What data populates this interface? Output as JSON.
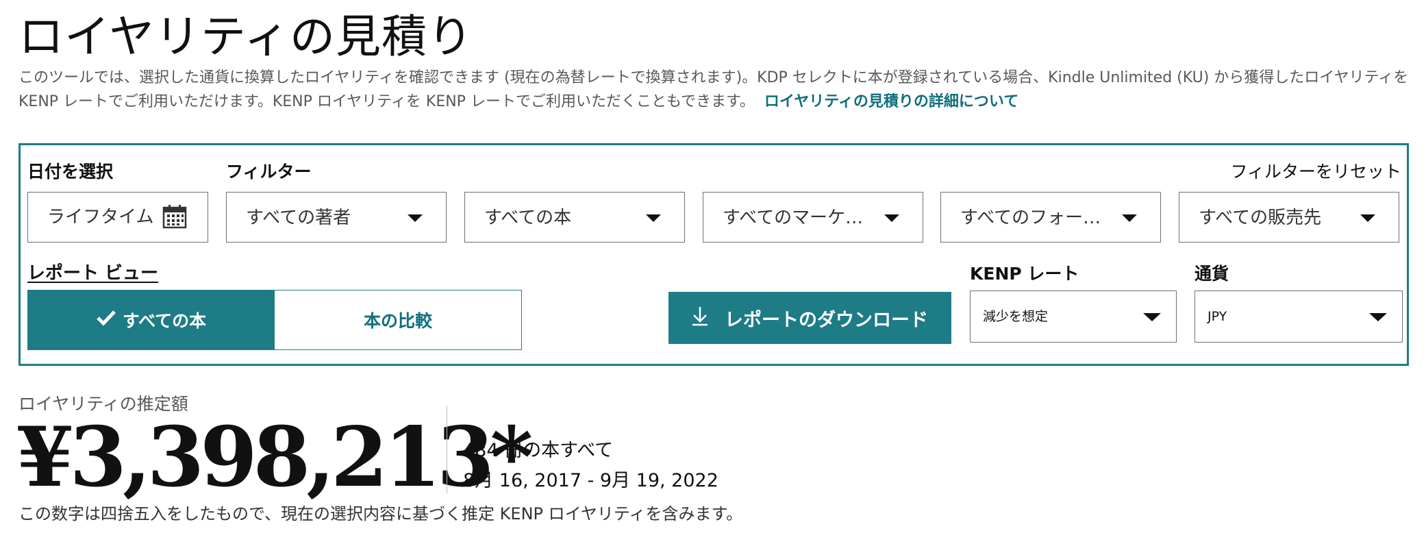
{
  "header": {
    "title": "ロイヤリティの見積り",
    "description": "このツールでは、選択した通貨に換算したロイヤリティを確認できます (現在の為替レートで換算されます)。KDP セレクトに本が登録されている場合、Kindle Unlimited (KU) から獲得したロイヤリティを KENP レートでご利用いただけます。KENP ロイヤリティを KENP レートでご利用いただくこともできます。",
    "learn_more": "ロイヤリティの見積りの詳細について"
  },
  "filters": {
    "date_label": "日付を選択",
    "date_value": "ライフタイム",
    "filter_label": "フィルター",
    "reset": "フィルターをリセット",
    "authors": "すべての著者",
    "books": "すべての本",
    "marketplaces": "すべてのマーケ…",
    "formats": "すべてのフォー…",
    "sellers": "すべての販売先"
  },
  "report": {
    "view_label": "レポート ビュー",
    "all_books": "すべての本",
    "compare": "本の比較",
    "download": "レポートのダウンロード",
    "kenp_label": "KENP レート",
    "kenp_value": "減少を想定",
    "currency_label": "通貨",
    "currency_value": "JPY"
  },
  "estimate": {
    "label": "ロイヤリティの推定額",
    "amount": "¥3,398,213*",
    "books_count": "484 冊の本すべて",
    "date_range": "8月 16, 2017 - 9月 19, 2022",
    "note": "この数字は四捨五入をしたもので、現在の選択内容に基づく推定 KENP ロイヤリティを含みます。"
  },
  "colors": {
    "accent": "#1e7c87",
    "link": "#0f6f7c",
    "muted_text": "#565959"
  },
  "icons": {
    "calendar": "calendar-icon",
    "check": "check-icon",
    "download": "download-icon",
    "caret": "caret-down-icon"
  }
}
